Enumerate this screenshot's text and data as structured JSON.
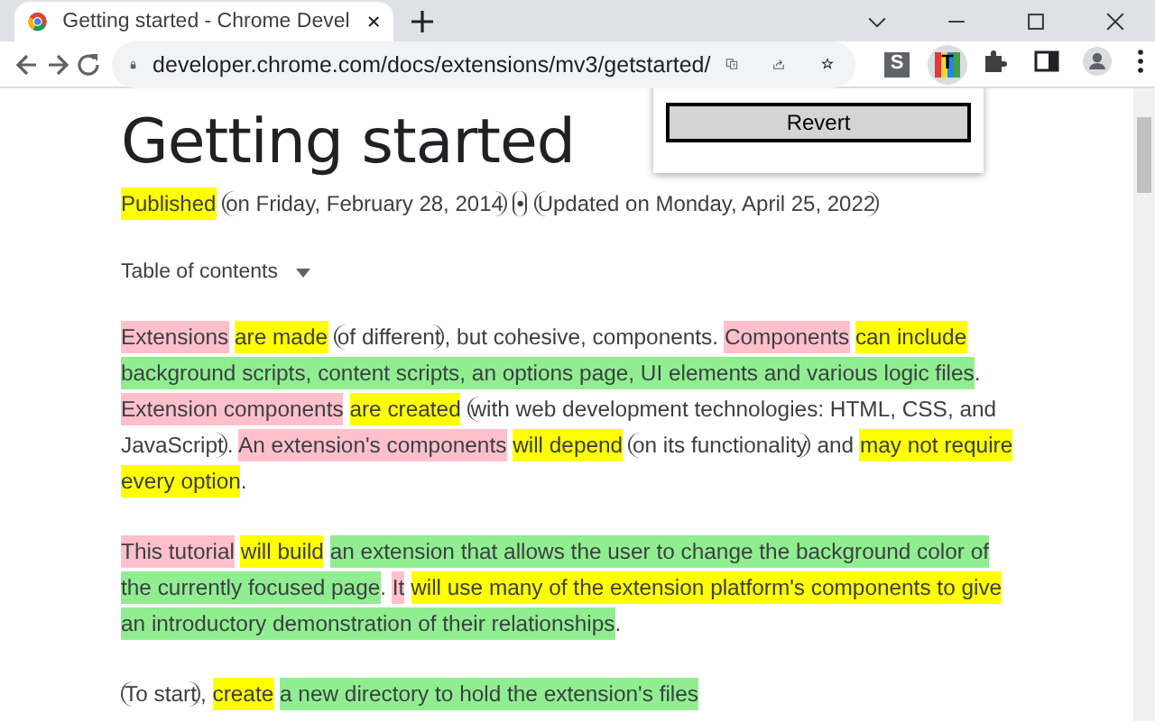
{
  "browser": {
    "tab": {
      "title": "Getting started - Chrome Devel"
    },
    "url": "developer.chrome.com/docs/extensions/mv3/getstarted/",
    "extensions": [
      {
        "kind": "plain",
        "label": "S",
        "selected": false
      },
      {
        "kind": "striped",
        "label": "T",
        "selected": true
      }
    ]
  },
  "popup": {
    "button": "Revert"
  },
  "article": {
    "title": "Getting started",
    "meta": [
      {
        "text": "Published",
        "kind": "verb"
      },
      {
        "text": "on Friday, February 28, 2014",
        "kind": "modifier"
      },
      {
        "text": "•",
        "kind": "modifier"
      },
      {
        "text": "Updated on Monday, April 25, 2022",
        "kind": "modifier"
      }
    ],
    "toc": "Table of contents",
    "paragraphs": [
      [
        {
          "text": "Extensions",
          "kind": "subject"
        },
        {
          "text": "are made",
          "kind": "verb"
        },
        {
          "text": "of different",
          "kind": "modifier"
        },
        {
          "text": ", but cohesive, components. ",
          "kind": "plain"
        },
        {
          "text": "Components",
          "kind": "subject"
        },
        {
          "text": "can include",
          "kind": "verb"
        },
        {
          "text": "background scripts, content scripts, an options page, UI elements and various logic files",
          "kind": "object"
        },
        {
          "text": ". ",
          "kind": "plain"
        },
        {
          "text": "Extension components",
          "kind": "subject"
        },
        {
          "text": "are created",
          "kind": "verb"
        },
        {
          "text": "with web development technologies: HTML, CSS, and JavaScript",
          "kind": "modifier"
        },
        {
          "text": ". ",
          "kind": "plain"
        },
        {
          "text": "An extension's components",
          "kind": "subject"
        },
        {
          "text": "will depend",
          "kind": "verb"
        },
        {
          "text": "on its functionality",
          "kind": "modifier"
        },
        {
          "text": " and ",
          "kind": "plain"
        },
        {
          "text": "may not require every option",
          "kind": "verb"
        },
        {
          "text": ".",
          "kind": "plain"
        }
      ],
      [
        {
          "text": "This tutorial",
          "kind": "subject"
        },
        {
          "text": "will build",
          "kind": "verb"
        },
        {
          "text": "an extension that allows the user to change the background color of the currently focused page",
          "kind": "object"
        },
        {
          "text": ". ",
          "kind": "plain"
        },
        {
          "text": "It",
          "kind": "subject"
        },
        {
          "text": "will use many of the extension platform's components to give",
          "kind": "verb"
        },
        {
          "text": "an introductory demonstration of their relationships",
          "kind": "object"
        },
        {
          "text": ".",
          "kind": "plain"
        }
      ],
      [
        {
          "text": "To start",
          "kind": "modifier"
        },
        {
          "text": ", ",
          "kind": "plain"
        },
        {
          "text": "create",
          "kind": "verb"
        },
        {
          "text": "a new directory to hold the extension's files",
          "kind": "object"
        }
      ]
    ]
  }
}
